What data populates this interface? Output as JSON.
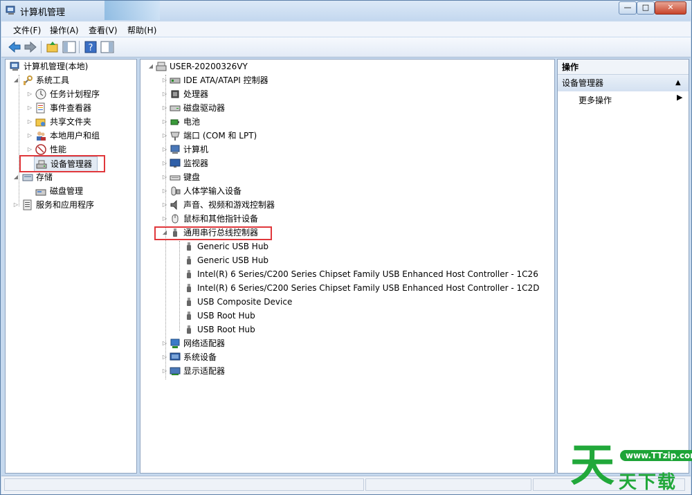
{
  "window": {
    "title": "计算机管理",
    "buttons": {
      "minimize": "—",
      "maximize": "□",
      "close": "✕"
    }
  },
  "menu": [
    "文件(F)",
    "操作(A)",
    "查看(V)",
    "帮助(H)"
  ],
  "left_tree": [
    {
      "label": "计算机管理(本地)",
      "icon": "computer-management-icon"
    },
    {
      "label": "系统工具",
      "icon": "tools-icon"
    },
    {
      "label": "任务计划程序",
      "icon": "clock-icon"
    },
    {
      "label": "事件查看器",
      "icon": "event-viewer-icon"
    },
    {
      "label": "共享文件夹",
      "icon": "shared-folder-icon"
    },
    {
      "label": "本地用户和组",
      "icon": "users-icon"
    },
    {
      "label": "性能",
      "icon": "performance-icon"
    },
    {
      "label": "设备管理器",
      "icon": "device-manager-icon"
    },
    {
      "label": "存储",
      "icon": "storage-icon"
    },
    {
      "label": "磁盘管理",
      "icon": "disk-management-icon"
    },
    {
      "label": "服务和应用程序",
      "icon": "services-icon"
    }
  ],
  "device_tree": {
    "root": "USER-20200326VY",
    "categories": [
      {
        "label": "IDE ATA/ATAPI 控制器",
        "icon": "ide-controller-icon"
      },
      {
        "label": "处理器",
        "icon": "processor-icon"
      },
      {
        "label": "磁盘驱动器",
        "icon": "disk-drive-icon"
      },
      {
        "label": "电池",
        "icon": "battery-icon"
      },
      {
        "label": "端口 (COM 和 LPT)",
        "icon": "port-icon"
      },
      {
        "label": "计算机",
        "icon": "computer-icon"
      },
      {
        "label": "监视器",
        "icon": "monitor-icon"
      },
      {
        "label": "键盘",
        "icon": "keyboard-icon"
      },
      {
        "label": "人体学输入设备",
        "icon": "hid-icon"
      },
      {
        "label": "声音、视频和游戏控制器",
        "icon": "sound-icon"
      },
      {
        "label": "鼠标和其他指针设备",
        "icon": "mouse-icon"
      },
      {
        "label": "通用串行总线控制器",
        "icon": "usb-controller-icon"
      }
    ],
    "usb_children": [
      "Generic USB Hub",
      "Generic USB Hub",
      "Intel(R) 6 Series/C200 Series Chipset Family USB Enhanced Host Controller - 1C26",
      "Intel(R) 6 Series/C200 Series Chipset Family USB Enhanced Host Controller - 1C2D",
      "USB Composite Device",
      "USB Root Hub",
      "USB Root Hub"
    ],
    "after": [
      {
        "label": "网络适配器",
        "icon": "network-adapter-icon"
      },
      {
        "label": "系统设备",
        "icon": "system-device-icon"
      },
      {
        "label": "显示适配器",
        "icon": "display-adapter-icon"
      }
    ]
  },
  "actions": {
    "header": "操作",
    "section": "设备管理器",
    "more": "更多操作"
  },
  "watermark": {
    "url": "www.TTzip.com",
    "big": "天",
    "small": "天下载"
  }
}
